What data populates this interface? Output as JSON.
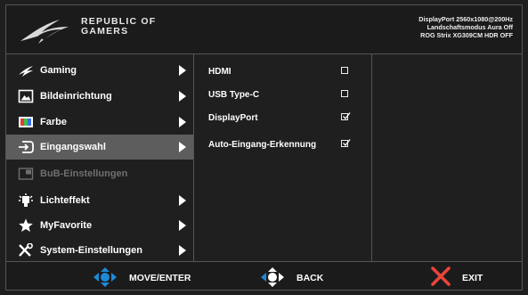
{
  "header": {
    "brand_line1": "REPUBLIC OF",
    "brand_line2": "GAMERS",
    "status_line1": "DisplayPort 2560x1080@200Hz",
    "status_line2": "Landschaftsmodus Aura Off",
    "status_line3": "ROG Strix XG309CM HDR OFF"
  },
  "menu": {
    "items": [
      {
        "label": "Gaming",
        "icon": "rog-eye-icon"
      },
      {
        "label": "Bildeinrichtung",
        "icon": "picture-icon"
      },
      {
        "label": "Farbe",
        "icon": "color-icon"
      },
      {
        "label": "Eingangswahl",
        "icon": "input-select-icon"
      },
      {
        "label": "BuB-Einstellungen",
        "icon": "pip-icon"
      },
      {
        "label": "Lichteffekt",
        "icon": "light-effect-icon"
      },
      {
        "label": "MyFavorite",
        "icon": "star-icon"
      },
      {
        "label": "System-Einstellungen",
        "icon": "tools-icon"
      }
    ]
  },
  "submenu": {
    "options": [
      {
        "label": "HDMI",
        "checked": false
      },
      {
        "label": "USB Type-C",
        "checked": false
      },
      {
        "label": "DisplayPort",
        "checked": true
      },
      {
        "label": "Auto-Eingang-Erkennung",
        "checked": true
      }
    ]
  },
  "footer": {
    "move_label": "MOVE/ENTER",
    "back_label": "BACK",
    "exit_label": "EXIT"
  },
  "colors": {
    "nav_blue": "#1d8ad8",
    "exit_red": "#e8453c",
    "active_row": "#5d5d5d"
  }
}
